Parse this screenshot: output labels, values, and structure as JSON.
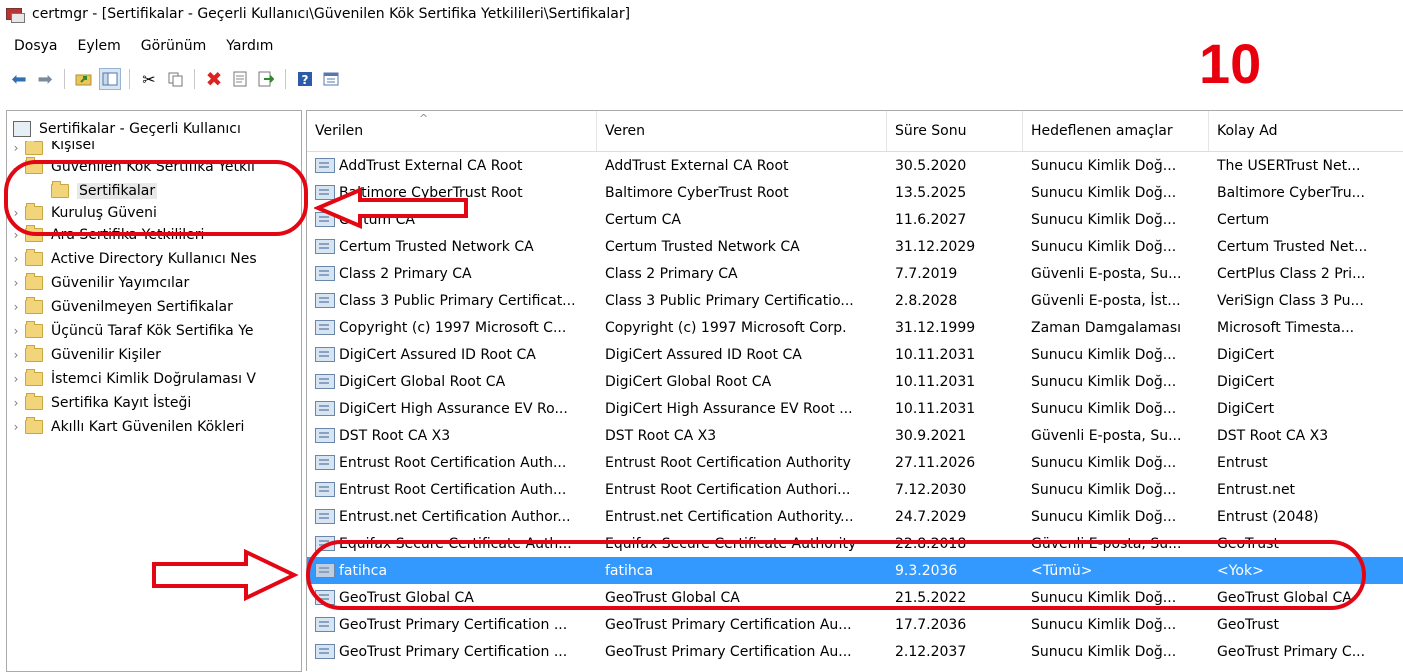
{
  "window": {
    "title": "certmgr - [Sertifikalar - Geçerli Kullanıcı\\Güvenilen Kök Sertifika Yetkilileri\\Sertifikalar]"
  },
  "menu": [
    "Dosya",
    "Eylem",
    "Görünüm",
    "Yardım"
  ],
  "toolbar": {
    "icons": [
      "back-arrow-icon",
      "forward-arrow-icon",
      "up-folder-icon",
      "show-hide-tree-icon",
      "cut-icon",
      "copy-icon",
      "delete-icon",
      "properties-icon",
      "export-icon",
      "help-icon",
      "mmc-view-icon"
    ]
  },
  "annotation_mark": "10",
  "tree": {
    "root": "Sertifikalar - Geçerli Kullanıcı",
    "items": [
      {
        "label": "Kişisel"
      },
      {
        "label": "Güvenilen Kök Sertifika Yetkil"
      },
      {
        "label": "Sertifikalar"
      },
      {
        "label": "Kuruluş Güveni"
      },
      {
        "label": "Ara Sertifika Yetkilileri"
      },
      {
        "label": "Active Directory Kullanıcı Nes"
      },
      {
        "label": "Güvenilir Yayımcılar"
      },
      {
        "label": "Güvenilmeyen Sertifikalar"
      },
      {
        "label": "Üçüncü Taraf Kök Sertifika Ye"
      },
      {
        "label": "Güvenilir Kişiler"
      },
      {
        "label": "İstemci Kimlik Doğrulaması V"
      },
      {
        "label": "Sertifika Kayıt İsteği"
      },
      {
        "label": "Akıllı Kart Güvenilen Kökleri"
      }
    ]
  },
  "columns": [
    "Verilen",
    "Veren",
    "Süre Sonu",
    "Hedeflenen amaçlar",
    "Kolay Ad"
  ],
  "rows": [
    [
      "AddTrust External CA Root",
      "AddTrust External CA Root",
      "30.5.2020",
      "Sunucu Kimlik Doğ...",
      "The USERTrust Net..."
    ],
    [
      "Baltimore CyberTrust Root",
      "Baltimore CyberTrust Root",
      "13.5.2025",
      "Sunucu Kimlik Doğ...",
      "Baltimore CyberTru..."
    ],
    [
      "Certum CA",
      "Certum CA",
      "11.6.2027",
      "Sunucu Kimlik Doğ...",
      "Certum"
    ],
    [
      "Certum Trusted Network CA",
      "Certum Trusted Network CA",
      "31.12.2029",
      "Sunucu Kimlik Doğ...",
      "Certum Trusted Net..."
    ],
    [
      "Class 2 Primary CA",
      "Class 2 Primary CA",
      "7.7.2019",
      "Güvenli E-posta, Su...",
      "CertPlus Class 2 Pri..."
    ],
    [
      "Class 3 Public Primary Certificat...",
      "Class 3 Public Primary Certificatio...",
      "2.8.2028",
      "Güvenli E-posta, İst...",
      "VeriSign Class 3 Pu..."
    ],
    [
      "Copyright (c) 1997 Microsoft C...",
      "Copyright (c) 1997 Microsoft Corp.",
      "31.12.1999",
      "Zaman Damgalaması",
      "Microsoft Timesta..."
    ],
    [
      "DigiCert Assured ID Root CA",
      "DigiCert Assured ID Root CA",
      "10.11.2031",
      "Sunucu Kimlik Doğ...",
      "DigiCert"
    ],
    [
      "DigiCert Global Root CA",
      "DigiCert Global Root CA",
      "10.11.2031",
      "Sunucu Kimlik Doğ...",
      "DigiCert"
    ],
    [
      "DigiCert High Assurance EV Ro...",
      "DigiCert High Assurance EV Root ...",
      "10.11.2031",
      "Sunucu Kimlik Doğ...",
      "DigiCert"
    ],
    [
      "DST Root CA X3",
      "DST Root CA X3",
      "30.9.2021",
      "Güvenli E-posta, Su...",
      "DST Root CA X3"
    ],
    [
      "Entrust Root Certification Auth...",
      "Entrust Root Certification Authority",
      "27.11.2026",
      "Sunucu Kimlik Doğ...",
      "Entrust"
    ],
    [
      "Entrust Root Certification Auth...",
      "Entrust Root Certification Authori...",
      "7.12.2030",
      "Sunucu Kimlik Doğ...",
      "Entrust.net"
    ],
    [
      "Entrust.net Certification Author...",
      "Entrust.net Certification Authority...",
      "24.7.2029",
      "Sunucu Kimlik Doğ...",
      "Entrust (2048)"
    ],
    [
      "Equifax Secure Certificate Auth...",
      "Equifax Secure Certificate Authority",
      "22.8.2018",
      "Güvenli E-posta, Su...",
      "GeoTrust"
    ],
    [
      "fatihca",
      "fatihca",
      "9.3.2036",
      "<Tümü>",
      "<Yok>"
    ],
    [
      "GeoTrust Global CA",
      "GeoTrust Global CA",
      "21.5.2022",
      "Sunucu Kimlik Doğ...",
      "GeoTrust Global CA"
    ],
    [
      "GeoTrust Primary Certification ...",
      "GeoTrust Primary Certification Au...",
      "17.7.2036",
      "Sunucu Kimlik Doğ...",
      "GeoTrust"
    ],
    [
      "GeoTrust Primary Certification ...",
      "GeoTrust Primary Certification Au...",
      "2.12.2037",
      "Sunucu Kimlik Doğ...",
      "GeoTrust Primary C..."
    ]
  ],
  "selected_row": 15,
  "colors": {
    "selection": "#3399ff",
    "annotation_red": "#e30613"
  }
}
